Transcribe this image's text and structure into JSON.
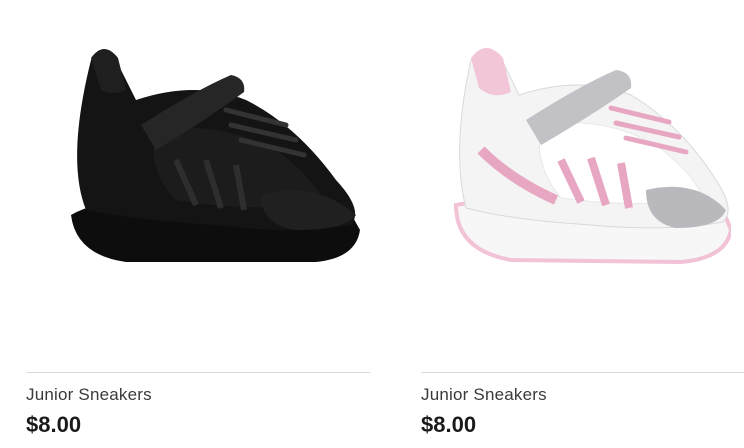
{
  "products": [
    {
      "name": "Junior Sneakers",
      "price": "$8.00",
      "image_icon": "black-sneaker-image",
      "colors": {
        "body": "#111111",
        "mesh": "#1c1c1c",
        "accent": "#2e2e2e",
        "sole": "#0d0d0d"
      }
    },
    {
      "name": "Junior Sneakers",
      "price": "$8.00",
      "image_icon": "pink-sneaker-image",
      "colors": {
        "body": "#f4f4f4",
        "mesh": "#ffffff",
        "accent": "#e7a7c2",
        "silver": "#b9b9bd",
        "sole": "#f2c2d6"
      }
    }
  ]
}
